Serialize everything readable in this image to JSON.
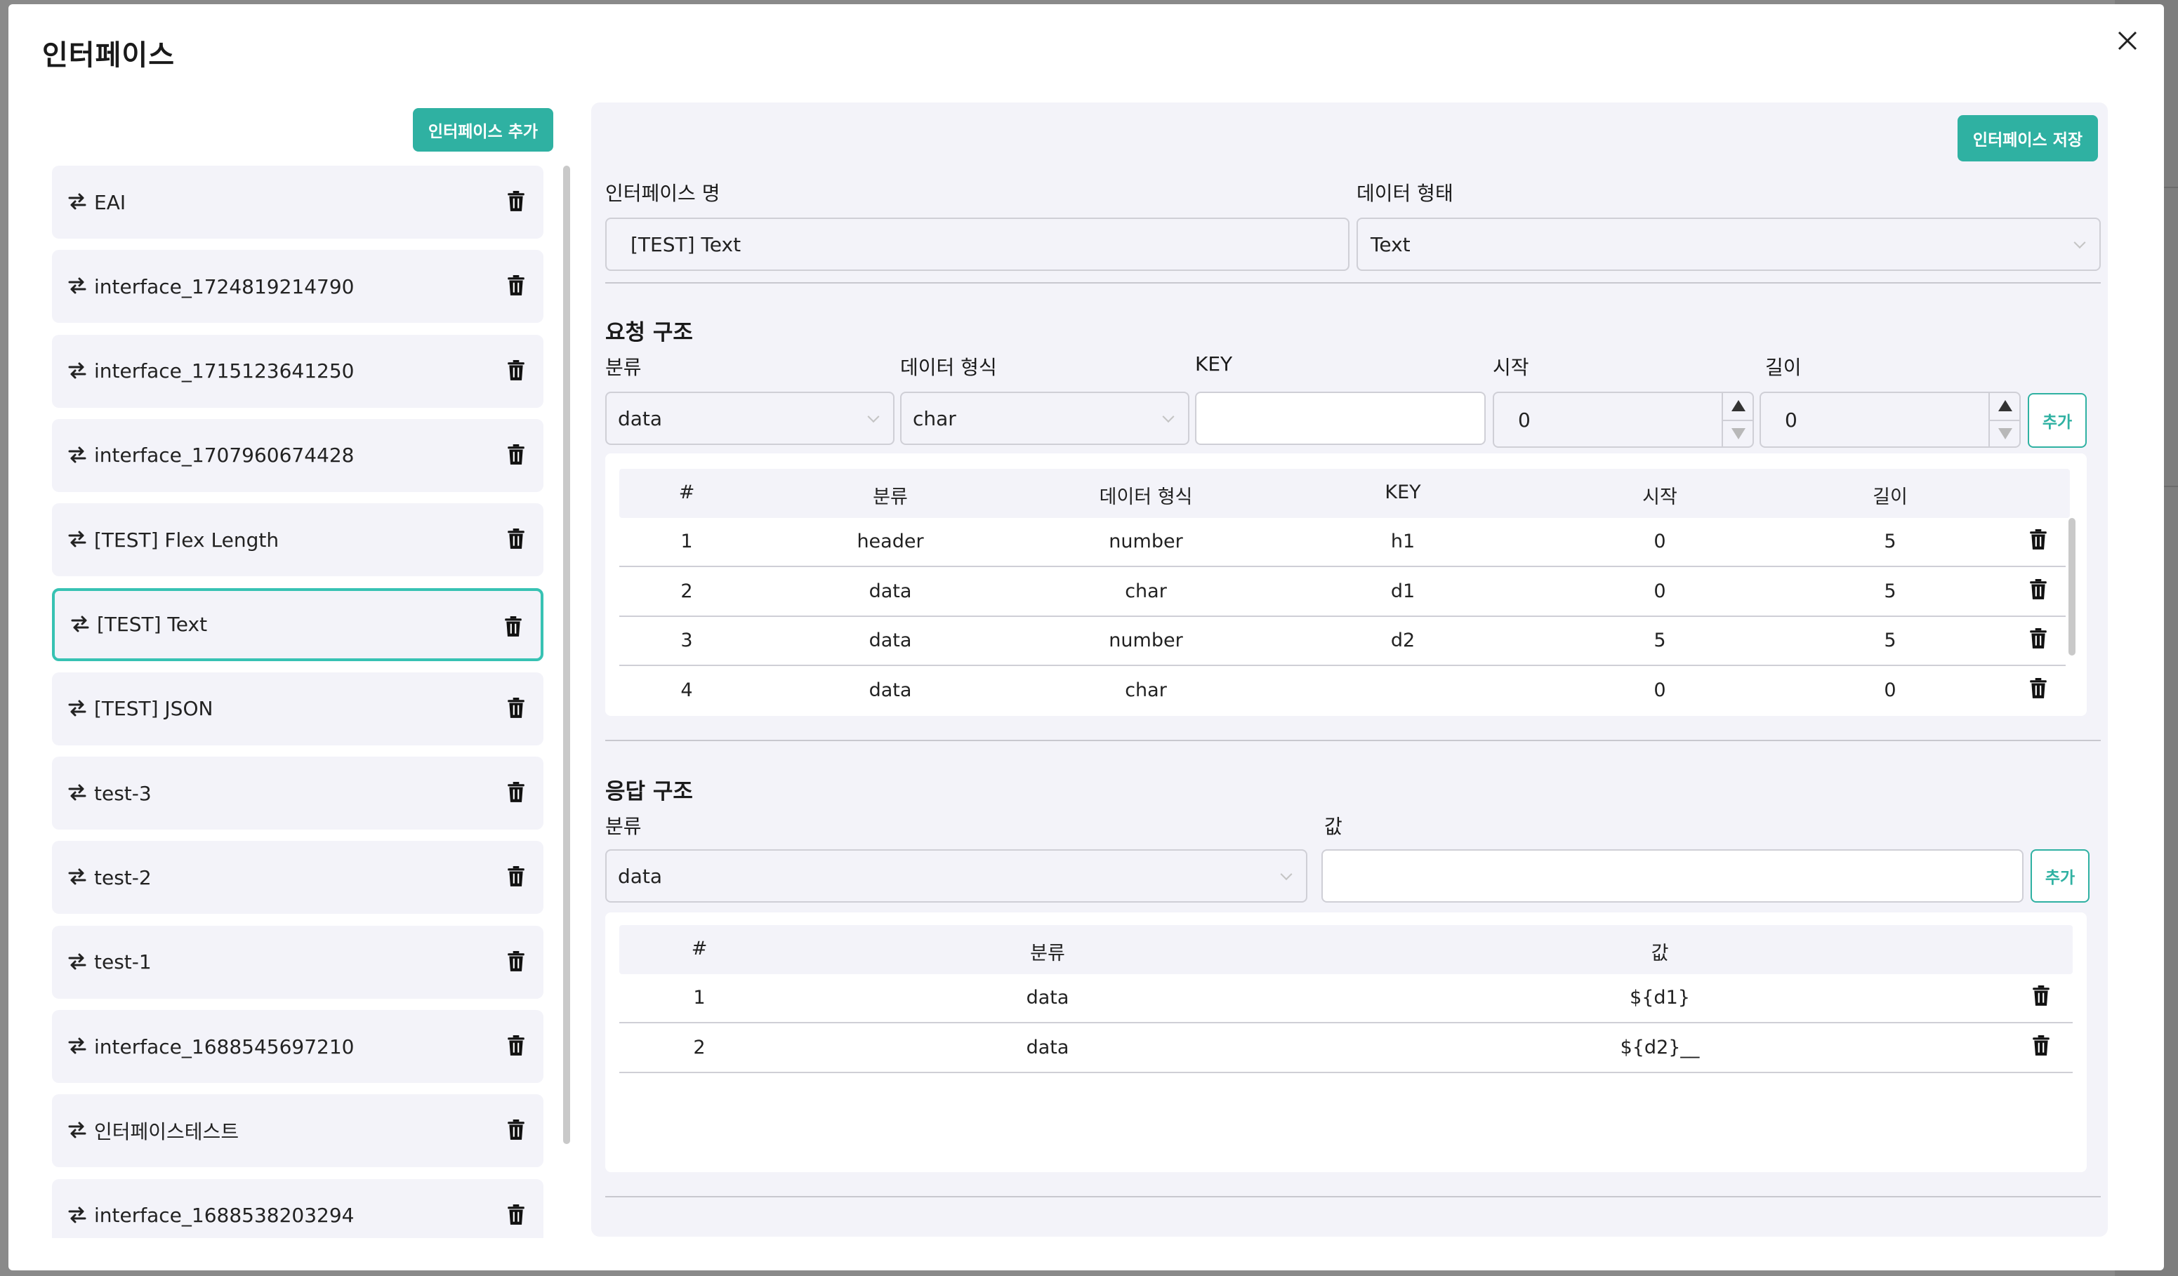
{
  "modal": {
    "title": "인터페이스",
    "add_button": "인터페이스 추가",
    "save_button": "인터페이스 저장"
  },
  "interfaces": [
    {
      "name": "EAI"
    },
    {
      "name": "interface_1724819214790"
    },
    {
      "name": "interface_1715123641250"
    },
    {
      "name": "interface_1707960674428"
    },
    {
      "name": "[TEST] Flex Length"
    },
    {
      "name": "[TEST] Text",
      "selected": true
    },
    {
      "name": "[TEST] JSON"
    },
    {
      "name": "test-3"
    },
    {
      "name": "test-2"
    },
    {
      "name": "test-1"
    },
    {
      "name": "interface_1688545697210"
    },
    {
      "name": "인터페이스테스트"
    },
    {
      "name": "interface_1688538203294"
    }
  ],
  "form": {
    "name_label": "인터페이스 명",
    "name_value": "[TEST] Text",
    "type_label": "데이터 형태",
    "type_value": "Text"
  },
  "request": {
    "section_title": "요청 구조",
    "category_label": "분류",
    "category_value": "data",
    "format_label": "데이터 형식",
    "format_value": "char",
    "key_label": "KEY",
    "key_value": "",
    "start_label": "시작",
    "start_value": "0",
    "length_label": "길이",
    "length_value": "0",
    "add_button": "추가",
    "columns": [
      "#",
      "분류",
      "데이터 형식",
      "KEY",
      "시작",
      "길이"
    ],
    "rows": [
      [
        "1",
        "header",
        "number",
        "h1",
        "0",
        "5"
      ],
      [
        "2",
        "data",
        "char",
        "d1",
        "0",
        "5"
      ],
      [
        "3",
        "data",
        "number",
        "d2",
        "5",
        "5"
      ],
      [
        "4",
        "data",
        "char",
        "",
        "0",
        "0"
      ]
    ]
  },
  "response": {
    "section_title": "응답 구조",
    "category_label": "분류",
    "category_value": "data",
    "value_label": "값",
    "value_value": "",
    "add_button": "추가",
    "columns": [
      "#",
      "분류",
      "값"
    ],
    "rows": [
      [
        "1",
        "data",
        "${d1}"
      ],
      [
        "2",
        "data",
        "${d2}__"
      ]
    ]
  },
  "colors": {
    "accent": "#2fb1a2",
    "selected_border": "#37c2b3",
    "panel_bg": "#f3f3f9"
  },
  "icons": {
    "close": "close-icon",
    "swap": "swap-arrows-icon",
    "trash": "trash-icon"
  }
}
